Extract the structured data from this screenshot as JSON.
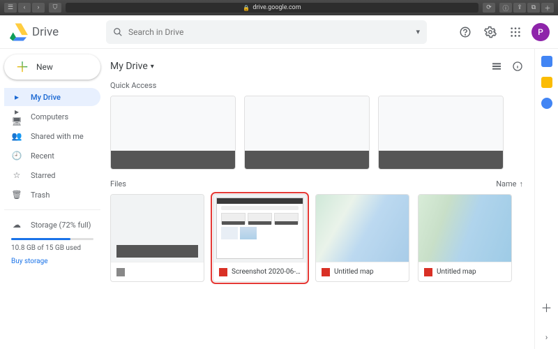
{
  "browser": {
    "url": "drive.google.com"
  },
  "app_name": "Drive",
  "search": {
    "placeholder": "Search in Drive"
  },
  "avatar_initial": "P",
  "new_button": "New",
  "sidebar": {
    "items": [
      {
        "label": "My Drive",
        "icon": "▸▢",
        "active": true
      },
      {
        "label": "Computers",
        "icon": "🖥"
      },
      {
        "label": "Shared with me",
        "icon": "👥"
      },
      {
        "label": "Recent",
        "icon": "🕘"
      },
      {
        "label": "Starred",
        "icon": "☆"
      },
      {
        "label": "Trash",
        "icon": "🗑"
      }
    ],
    "storage_label": "Storage (72% full)",
    "storage_used": "10.8 GB of 15 GB used",
    "buy": "Buy storage"
  },
  "path": "My Drive",
  "quick_access_label": "Quick Access",
  "files_label": "Files",
  "sort_label": "Name",
  "files": [
    {
      "name": "",
      "type": "unknown"
    },
    {
      "name": "Screenshot 2020-06-…",
      "type": "image",
      "selected": true
    },
    {
      "name": "Untitled map",
      "type": "map"
    },
    {
      "name": "Untitled map",
      "type": "map"
    }
  ]
}
